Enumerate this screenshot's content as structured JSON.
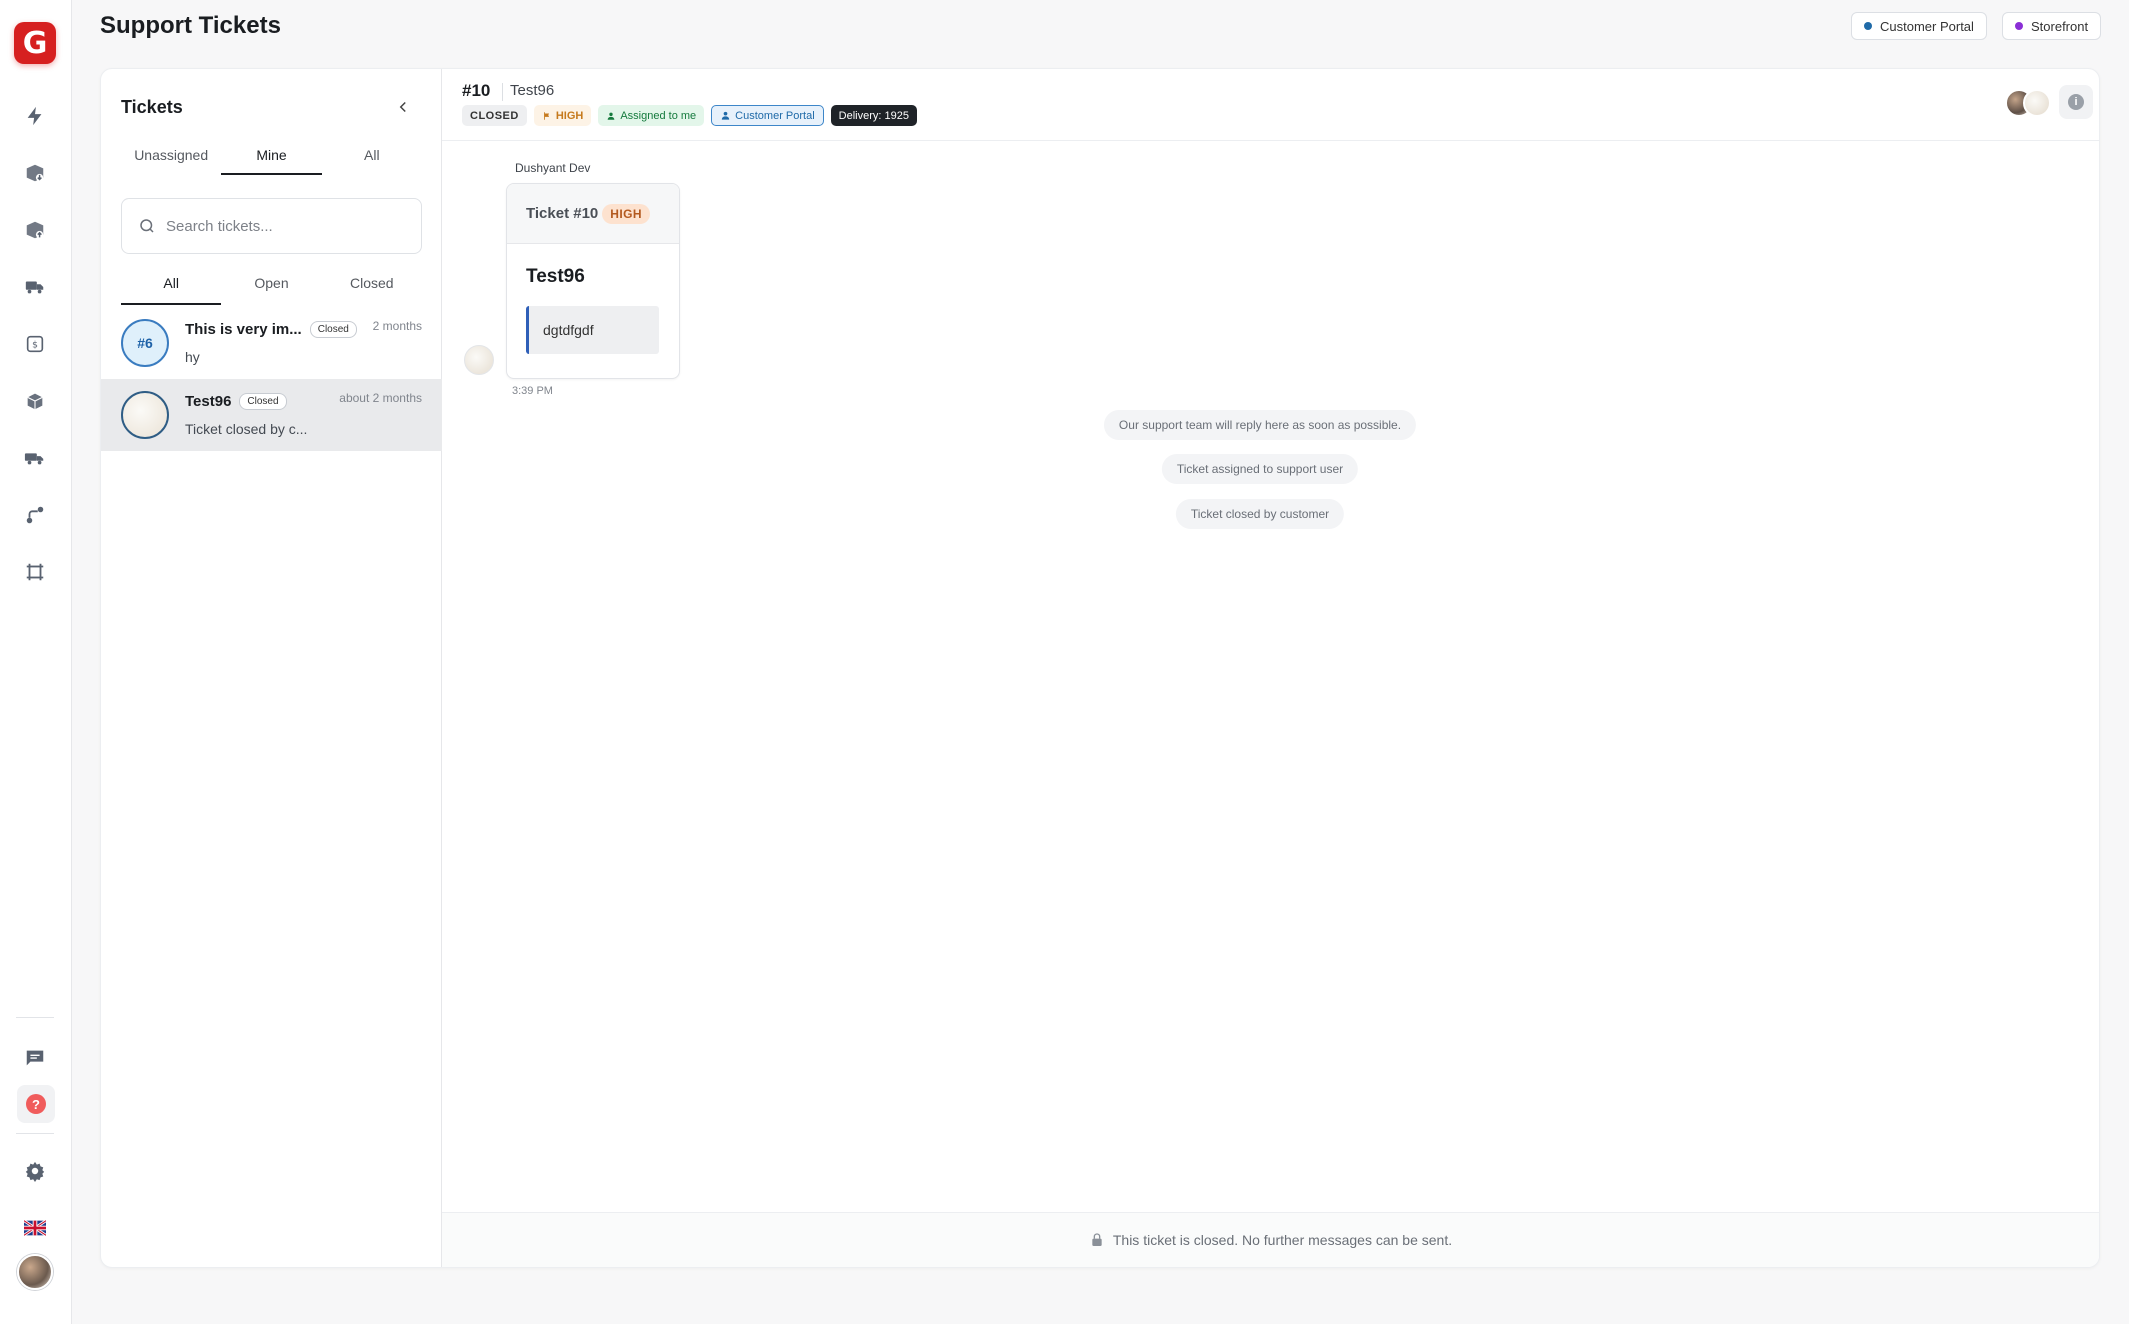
{
  "app": {
    "logo_letter": "G",
    "brand_color": "#d62020"
  },
  "header": {
    "title": "Support Tickets",
    "chips": [
      {
        "label": "Customer Portal",
        "dot_color": "#1f6aa8"
      },
      {
        "label": "Storefront",
        "dot_color": "#8b2fd6"
      }
    ]
  },
  "rail": {
    "icons": [
      "bolt-icon",
      "box-in-icon",
      "box-out-icon",
      "truck-icon",
      "money-icon",
      "boxes-icon",
      "delivery-truck-icon",
      "route-icon",
      "frame-icon"
    ],
    "bottom_icons": [
      "chat-icon",
      "help-icon",
      "gear-icon",
      "uk-flag-icon",
      "user-avatar"
    ],
    "help_glyph": "?"
  },
  "tickets_panel": {
    "title": "Tickets",
    "tabs": [
      "Unassigned",
      "Mine",
      "All"
    ],
    "active_tab": "Mine",
    "search_placeholder": "Search tickets...",
    "filters": [
      "All",
      "Open",
      "Closed"
    ],
    "active_filter": "All",
    "items": [
      {
        "avatar_text": "#6",
        "title": "This is very im...",
        "badge": "Closed",
        "time": "2 months",
        "subtitle": "hy",
        "selected": false
      },
      {
        "avatar_text": "",
        "title": "Test96",
        "badge": "Closed",
        "time": "about 2 months",
        "subtitle": "Ticket closed by c...",
        "selected": true
      }
    ]
  },
  "conversation": {
    "id": "#10",
    "name": "Test96",
    "pills": {
      "status": "CLOSED",
      "priority": "HIGH",
      "assigned": "Assigned to me",
      "portal": "Customer Portal",
      "delivery": "Delivery: 1925"
    },
    "info_glyph": "i",
    "message": {
      "sender": "Dushyant Dev",
      "ticket_label": "Ticket #10",
      "priority": "HIGH",
      "title": "Test96",
      "body": "dgtdfgdf",
      "time": "3:39 PM"
    },
    "system_messages": [
      "Our support team will reply here as soon as possible.",
      "Ticket assigned to support user",
      "Ticket closed by customer"
    ],
    "footer_note": "This ticket is closed. No further messages can be sent."
  }
}
